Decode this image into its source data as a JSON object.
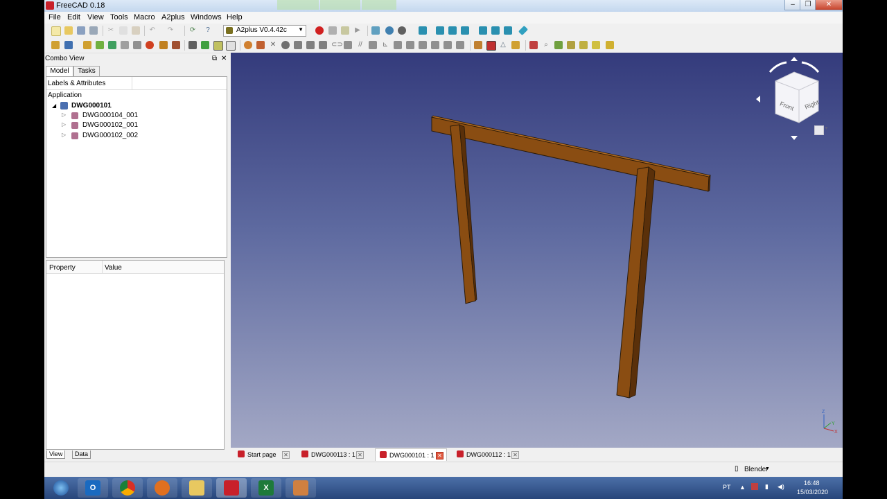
{
  "window": {
    "title": "FreeCAD 0.18"
  },
  "menu": [
    "File",
    "Edit",
    "View",
    "Tools",
    "Macro",
    "A2plus",
    "Windows",
    "Help"
  ],
  "toolbar": {
    "workbench": "A2plus V0.4.42c"
  },
  "combo": {
    "title": "Combo View",
    "tabs": [
      "Model",
      "Tasks"
    ],
    "header": "Labels & Attributes",
    "application": "Application",
    "document": "DWG000101",
    "parts": [
      "DWG000104_001",
      "DWG000102_001",
      "DWG000102_002"
    ],
    "prop_headers": [
      "Property",
      "Value"
    ],
    "bottom_tabs": [
      "View",
      "Data"
    ]
  },
  "navcube": {
    "front": "Front",
    "right": "Right"
  },
  "doc_tabs": [
    {
      "label": "Start page",
      "active": false
    },
    {
      "label": "DWG000113 : 1",
      "active": false
    },
    {
      "label": "DWG000101 : 1",
      "active": true
    },
    {
      "label": "DWG000112 : 1",
      "active": false
    }
  ],
  "status": {
    "nav_style": "Blender"
  },
  "tray": {
    "lang": "PT",
    "time": "16:48",
    "date": "15/03/2020"
  },
  "colors": {
    "wood": "#8a4d12",
    "wood_dark": "#5a300a",
    "viewport_top": "#343b7c",
    "viewport_bottom": "#a3a8c5"
  }
}
